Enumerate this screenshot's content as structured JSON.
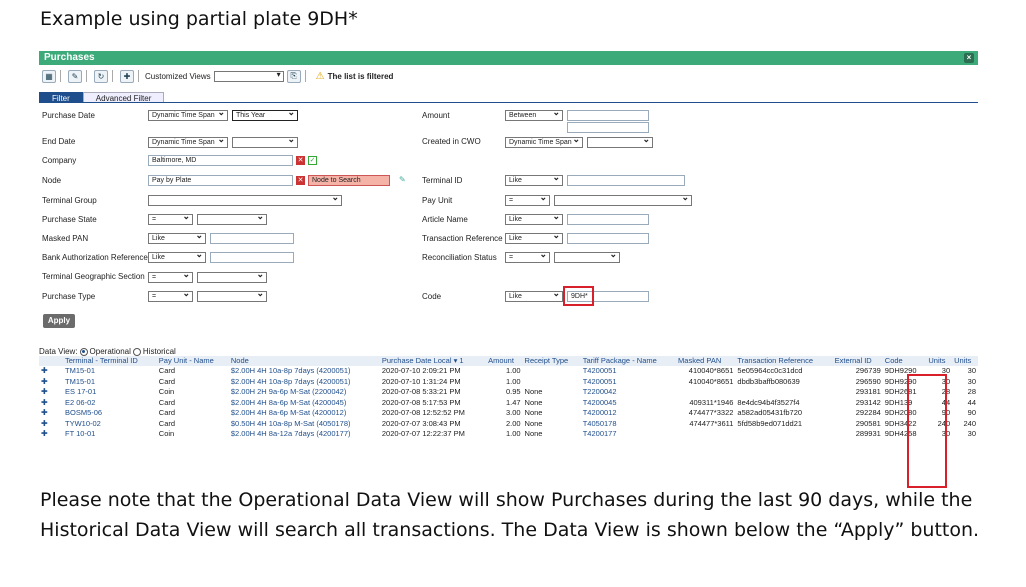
{
  "heading": "Example using partial plate 9DH*",
  "window": {
    "title": "Purchases",
    "close_glyph": "×"
  },
  "toolbar": {
    "customized_views_label": "Customized Views",
    "customized_views_value": "",
    "filtered_text": "The list is filtered",
    "icons": [
      "excel-icon",
      "clear-icon",
      "refresh-icon",
      "pin-icon",
      "save-view-icon",
      "warning-icon"
    ]
  },
  "tabs": [
    {
      "label": "Filter",
      "active": true
    },
    {
      "label": "Advanced Filter",
      "active": false
    }
  ],
  "filters_left": [
    {
      "label": "Purchase Date",
      "sel1": "Dynamic Time Span",
      "sel2": "This Year"
    },
    {
      "label": "End Date",
      "sel1": "Dynamic Time Span",
      "sel2": ""
    },
    {
      "label": "Company",
      "value": "Baltimore, MD"
    },
    {
      "label": "Node",
      "value": "Pay by Plate",
      "extra": "Node to Search"
    },
    {
      "label": "Terminal Group",
      "value": ""
    },
    {
      "label": "Purchase State",
      "sel1": "=",
      "sel2": ""
    },
    {
      "label": "Masked PAN",
      "sel1": "Like",
      "value": ""
    },
    {
      "label": "Bank Authorization Reference",
      "sel1": "Like",
      "value": ""
    },
    {
      "label": "Terminal Geographic Section",
      "sel1": "=",
      "sel2": ""
    },
    {
      "label": "Purchase Type",
      "sel1": "=",
      "sel2": ""
    }
  ],
  "filters_right": [
    {
      "label": "Amount",
      "sel1": "Between",
      "value": ""
    },
    {
      "label": "Created in CWO",
      "sel1": "Dynamic Time Span",
      "sel2": ""
    },
    {
      "label": "Terminal ID",
      "sel1": "Like",
      "value": ""
    },
    {
      "label": "Pay Unit",
      "sel1": "=",
      "sel2": ""
    },
    {
      "label": "Article Name",
      "sel1": "Like",
      "value": ""
    },
    {
      "label": "Transaction Reference",
      "sel1": "Like",
      "value": ""
    },
    {
      "label": "Reconciliation Status",
      "sel1": "=",
      "sel2": ""
    },
    {
      "label": "Code",
      "sel1": "Like",
      "value": "9DH*"
    }
  ],
  "apply_label": "Apply",
  "data_view": {
    "label": "Data View:",
    "operational": "Operational",
    "historical": "Historical"
  },
  "table": {
    "columns": [
      "Terminal - Terminal ID",
      "Pay Unit - Name",
      "Node",
      "Purchase Date Local ▾ 1",
      "Amount",
      "Receipt Type",
      "Tariff Package - Name",
      "Masked PAN",
      "Transaction Reference",
      "External ID",
      "Code",
      "Units",
      "Units"
    ],
    "rows": [
      [
        "TM15-01",
        "Card",
        "$2.00H 4H 10a-8p 7days (4200051)",
        "2020-07-10 2:09:21 PM",
        "1.00",
        "",
        "T4200051",
        "410040*8651",
        "5e05964cc0c31dcd",
        "296739",
        "9DH9290",
        "30",
        "30"
      ],
      [
        "TM15-01",
        "Card",
        "$2.00H 4H 10a-8p 7days (4200051)",
        "2020-07-10 1:31:24 PM",
        "1.00",
        "",
        "T4200051",
        "410040*8651",
        "dbdb3baffb080639",
        "296590",
        "9DH9290",
        "30",
        "30"
      ],
      [
        "ES 17-01",
        "Coin",
        "$2.00H 2H 9a-6p M-Sat (2200042)",
        "2020-07-08 5:33:21 PM",
        "0.95",
        "None",
        "T2200042",
        "",
        "",
        "293181",
        "9DH2681",
        "28",
        "28"
      ],
      [
        "E2 06-02",
        "Card",
        "$2.00H 4H 8a-6p M-Sat (4200045)",
        "2020-07-08 5:17:53 PM",
        "1.47",
        "None",
        "T4200045",
        "409311*1946",
        "8e4dc94b4f3527f4",
        "293142",
        "9DH139",
        "44",
        "44"
      ],
      [
        "BOSM5-06",
        "Card",
        "$2.00H 4H 8a-6p M-Sat (4200012)",
        "2020-07-08 12:52:52 PM",
        "3.00",
        "None",
        "T4200012",
        "474477*3322",
        "a582ad05431fb720",
        "292284",
        "9DH2080",
        "90",
        "90"
      ],
      [
        "TYW10-02",
        "Card",
        "$0.50H 4H 10a-8p M-Sat (4050178)",
        "2020-07-07 3:08:43 PM",
        "2.00",
        "None",
        "T4050178",
        "474477*3611",
        "5fd58b9ed071dd21",
        "290581",
        "9DH3422",
        "240",
        "240"
      ],
      [
        "FT 10-01",
        "Coin",
        "$2.00H 4H 8a-12a 7days (4200177)",
        "2020-07-07 12:22:37 PM",
        "1.00",
        "None",
        "T4200177",
        "",
        "",
        "289931",
        "9DH4258",
        "30",
        "30"
      ]
    ]
  },
  "note": "Please note that the Operational Data View will show Purchases during the last 90 days, while the Historical Data View will search all transactions.  The Data View is shown below the “Apply” button."
}
